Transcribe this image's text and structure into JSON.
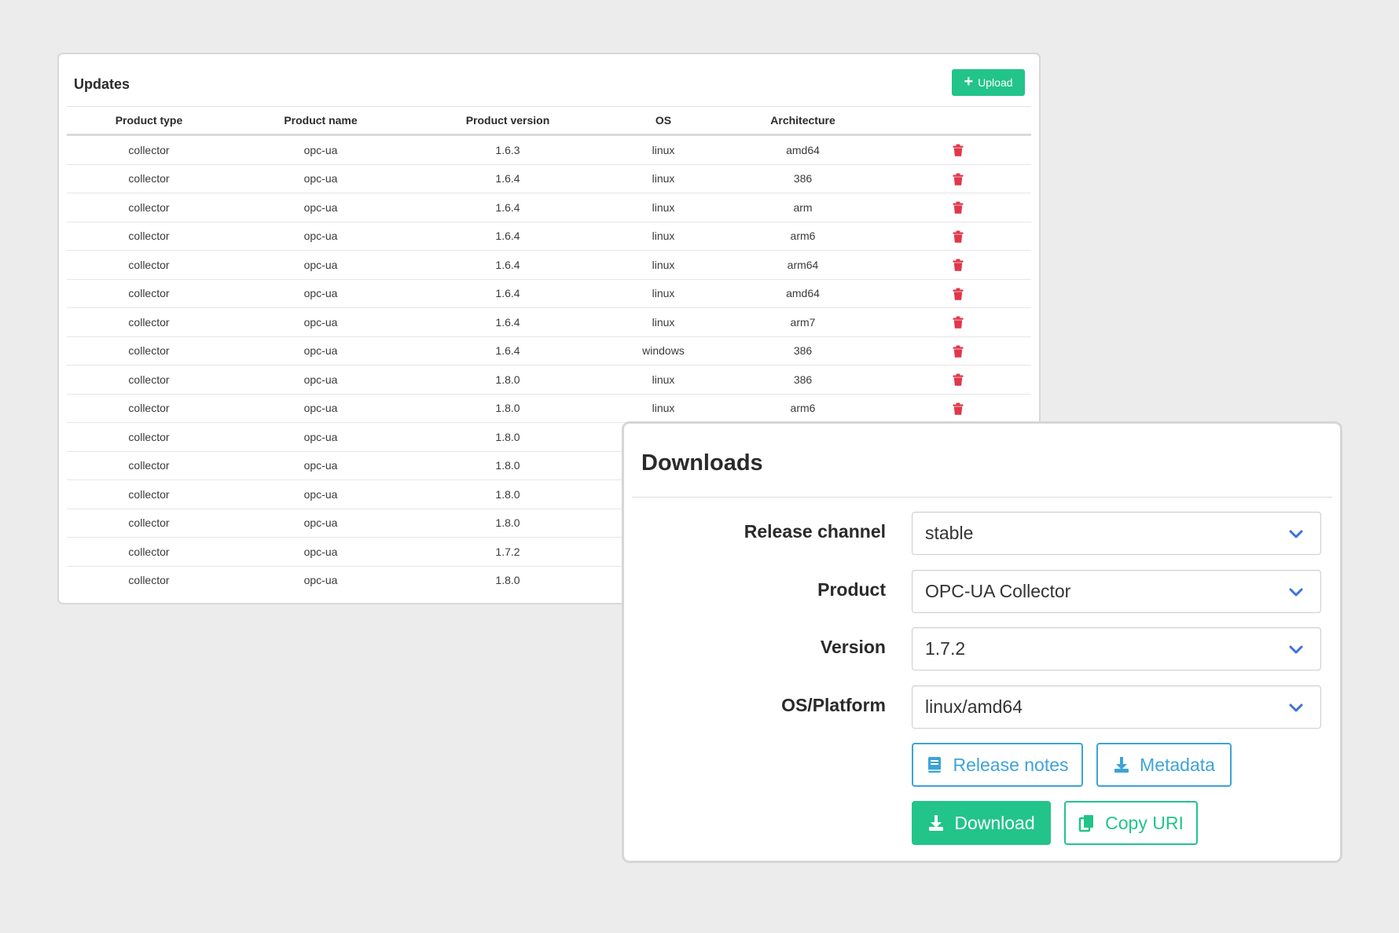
{
  "updates": {
    "title": "Updates",
    "upload_label": "Upload",
    "columns": [
      "Product type",
      "Product name",
      "Product version",
      "OS",
      "Architecture"
    ],
    "rows": [
      [
        "collector",
        "opc-ua",
        "1.6.3",
        "linux",
        "amd64"
      ],
      [
        "collector",
        "opc-ua",
        "1.6.4",
        "linux",
        "386"
      ],
      [
        "collector",
        "opc-ua",
        "1.6.4",
        "linux",
        "arm"
      ],
      [
        "collector",
        "opc-ua",
        "1.6.4",
        "linux",
        "arm6"
      ],
      [
        "collector",
        "opc-ua",
        "1.6.4",
        "linux",
        "arm64"
      ],
      [
        "collector",
        "opc-ua",
        "1.6.4",
        "linux",
        "amd64"
      ],
      [
        "collector",
        "opc-ua",
        "1.6.4",
        "linux",
        "arm7"
      ],
      [
        "collector",
        "opc-ua",
        "1.6.4",
        "windows",
        "386"
      ],
      [
        "collector",
        "opc-ua",
        "1.8.0",
        "linux",
        "386"
      ],
      [
        "collector",
        "opc-ua",
        "1.8.0",
        "linux",
        "arm6"
      ],
      [
        "collector",
        "opc-ua",
        "1.8.0",
        "",
        ""
      ],
      [
        "collector",
        "opc-ua",
        "1.8.0",
        "",
        ""
      ],
      [
        "collector",
        "opc-ua",
        "1.8.0",
        "",
        ""
      ],
      [
        "collector",
        "opc-ua",
        "1.8.0",
        "",
        ""
      ],
      [
        "collector",
        "opc-ua",
        "1.7.2",
        "",
        ""
      ],
      [
        "collector",
        "opc-ua",
        "1.8.0",
        "",
        ""
      ]
    ],
    "delete_icon": "trash-icon",
    "delete_color": "#e0374a"
  },
  "downloads": {
    "title": "Downloads",
    "fields": [
      {
        "label": "Release channel",
        "value": "stable"
      },
      {
        "label": "Product",
        "value": "OPC-UA Collector"
      },
      {
        "label": "Version",
        "value": "1.7.2"
      },
      {
        "label": "OS/Platform",
        "value": "linux/amd64"
      }
    ],
    "buttons": {
      "release_notes": "Release notes",
      "metadata": "Metadata",
      "download": "Download",
      "copy_uri": "Copy URI"
    }
  },
  "colors": {
    "accent_green": "#22c48a",
    "accent_blue": "#3ea3d8",
    "chevron_blue": "#3d73d6",
    "danger": "#e0374a"
  }
}
